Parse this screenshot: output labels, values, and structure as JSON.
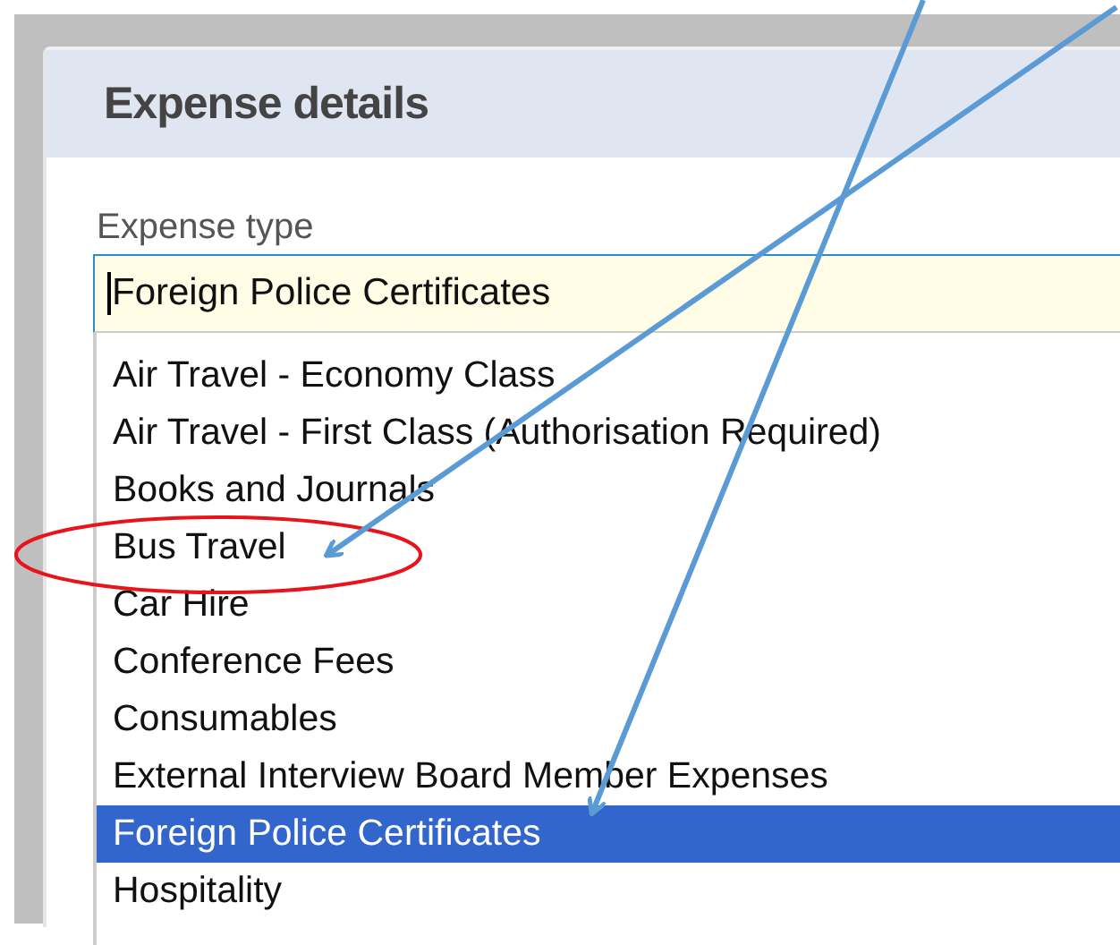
{
  "panel": {
    "title": "Expense details"
  },
  "expense_type": {
    "label": "Expense type",
    "value": "Foreign Police Certificates"
  },
  "options": [
    {
      "label": "Air Travel - Economy Class",
      "selected": false
    },
    {
      "label": "Air Travel - First Class (Authorisation Required)",
      "selected": false
    },
    {
      "label": "Books and Journals",
      "selected": false
    },
    {
      "label": "Bus Travel",
      "selected": false
    },
    {
      "label": "Car Hire",
      "selected": false
    },
    {
      "label": "Conference Fees",
      "selected": false
    },
    {
      "label": "Consumables",
      "selected": false
    },
    {
      "label": "External Interview Board Member Expenses",
      "selected": false
    },
    {
      "label": "Foreign Police Certificates",
      "selected": true
    },
    {
      "label": "Hospitality",
      "selected": false
    }
  ]
}
